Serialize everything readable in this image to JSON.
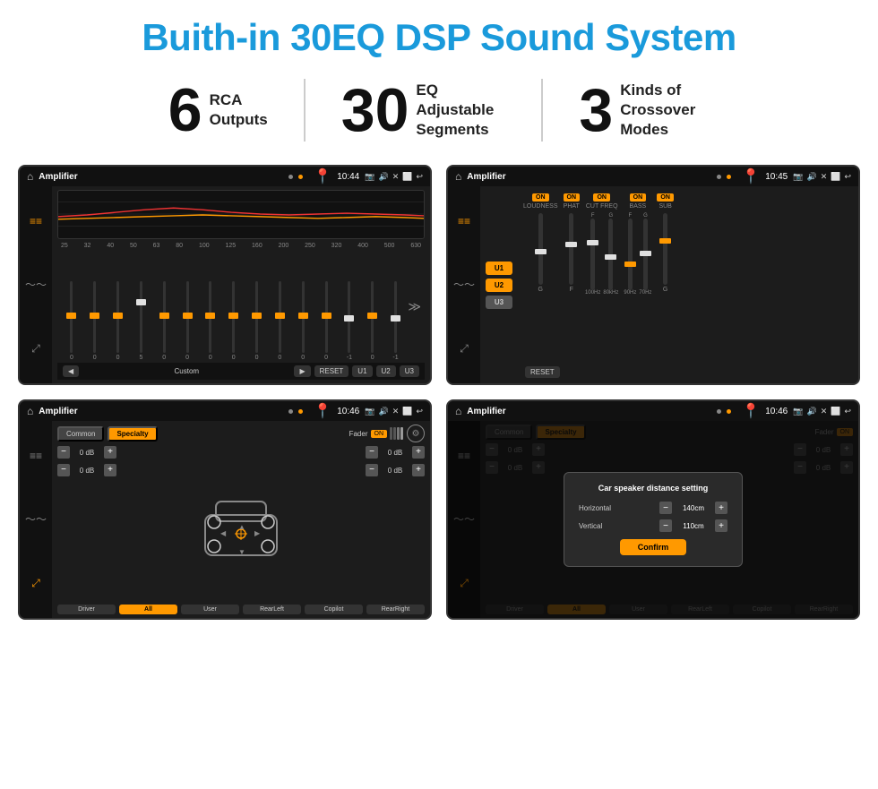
{
  "page": {
    "title": "Buith-in 30EQ DSP Sound System"
  },
  "stats": [
    {
      "id": "rca",
      "number": "6",
      "label_line1": "RCA",
      "label_line2": "Outputs"
    },
    {
      "id": "eq",
      "number": "30",
      "label_line1": "EQ Adjustable",
      "label_line2": "Segments"
    },
    {
      "id": "crossover",
      "number": "3",
      "label_line1": "Kinds of",
      "label_line2": "Crossover Modes"
    }
  ],
  "screens": {
    "screen1": {
      "title": "Amplifier",
      "time": "10:44",
      "freq_labels": [
        "25",
        "32",
        "40",
        "50",
        "63",
        "80",
        "100",
        "125",
        "160",
        "200",
        "250",
        "320",
        "400",
        "500",
        "630"
      ],
      "eq_values": [
        "0",
        "0",
        "0",
        "5",
        "0",
        "0",
        "0",
        "0",
        "0",
        "0",
        "0",
        "0",
        "-1",
        "0",
        "-1"
      ],
      "bottom_buttons": [
        "Custom",
        "RESET",
        "U1",
        "U2",
        "U3"
      ]
    },
    "screen2": {
      "title": "Amplifier",
      "time": "10:45",
      "u_buttons": [
        "U1",
        "U2",
        "U3"
      ],
      "controls": [
        "LOUDNESS",
        "PHAT",
        "CUT FREQ",
        "BASS",
        "SUB"
      ],
      "reset_label": "RESET"
    },
    "screen3": {
      "title": "Amplifier",
      "time": "10:46",
      "tabs": [
        "Common",
        "Specialty"
      ],
      "fader_label": "Fader",
      "fader_on": "ON",
      "db_values": [
        "0 dB",
        "0 dB",
        "0 dB",
        "0 dB"
      ],
      "bottom_buttons": [
        "Driver",
        "All",
        "User",
        "RearLeft",
        "Copilot",
        "RearRight"
      ]
    },
    "screen4": {
      "title": "Amplifier",
      "time": "10:46",
      "tabs": [
        "Common",
        "Specialty"
      ],
      "dialog": {
        "title": "Car speaker distance setting",
        "horizontal_label": "Horizontal",
        "horizontal_value": "140cm",
        "vertical_label": "Vertical",
        "vertical_value": "110cm",
        "confirm_label": "Confirm"
      },
      "bottom_buttons": [
        "Driver",
        "All",
        "User",
        "RearLeft",
        "Copilot",
        "RearRight"
      ]
    }
  },
  "icons": {
    "home": "⌂",
    "settings": "⚙",
    "back": "↩",
    "play": "▶",
    "prev": "◀",
    "location": "📍",
    "camera": "📷",
    "volume": "🔊",
    "close_x": "✕",
    "window": "⬜",
    "equalizer": "≡",
    "wave": "〜",
    "arrows": "⤢"
  }
}
